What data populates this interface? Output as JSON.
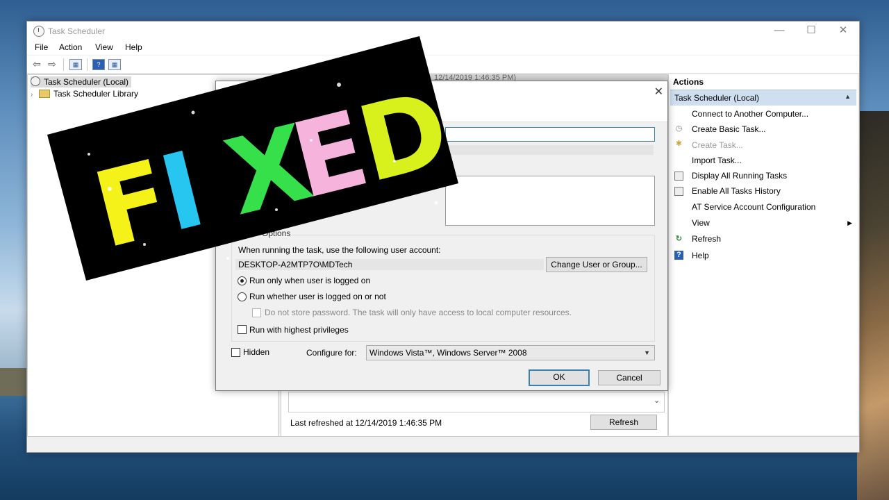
{
  "window": {
    "title": "Task Scheduler",
    "controls": {
      "minimize": "—",
      "maximize": "☐",
      "close": "✕"
    }
  },
  "menubar": {
    "items": [
      "File",
      "Action",
      "View",
      "Help"
    ]
  },
  "toolbar": {
    "back_icon": "arrow-left-icon",
    "forward_icon": "arrow-right-icon"
  },
  "tree": {
    "root": "Task Scheduler (Local)",
    "library": "Task Scheduler Library"
  },
  "middle": {
    "header_fragment": "12/14/2019 1:46:35 PM)",
    "last_refreshed": "Last refreshed at 12/14/2019 1:46:35 PM",
    "refresh_button": "Refresh"
  },
  "actions": {
    "title": "Actions",
    "section": "Task Scheduler (Local)",
    "items": [
      {
        "label": "Connect to Another Computer...",
        "icon": "none"
      },
      {
        "label": "Create Basic Task...",
        "icon": "clock-icon"
      },
      {
        "label": "Create Task...",
        "icon": "task-icon",
        "disabled": true
      },
      {
        "label": "Import Task...",
        "icon": "none"
      },
      {
        "label": "Display All Running Tasks",
        "icon": "tasks-icon"
      },
      {
        "label": "Enable All Tasks History",
        "icon": "history-icon"
      },
      {
        "label": "AT Service Account Configuration",
        "icon": "none"
      },
      {
        "label": "View",
        "icon": "none"
      },
      {
        "label": "Refresh",
        "icon": "refresh-icon"
      },
      {
        "label": "Help",
        "icon": "help-icon"
      }
    ]
  },
  "dialog": {
    "close": "✕",
    "security_section_title": "Options",
    "account_prompt": "When running the task, use the following user account:",
    "account": "DESKTOP-A2MTP7O\\MDTech",
    "change_user_button": "Change User or Group...",
    "radio_logged_on": "Run only when user is logged on",
    "radio_logged_on_or_not": "Run whether user is logged on or not",
    "do_not_store": "Do not store password.  The task will only have access to local computer resources.",
    "highest_priv": "Run with highest privileges",
    "hidden": "Hidden",
    "configure_for_label": "Configure for:",
    "configure_for_value": "Windows Vista™, Windows Server™ 2008",
    "ok": "OK",
    "cancel": "Cancel"
  },
  "overlay": {
    "stamp_text": "FIXED",
    "letter_colors": [
      "#f5f21a",
      "#26c6f0",
      "#35e04a",
      "#f6b4dc",
      "#d8f01c"
    ]
  }
}
